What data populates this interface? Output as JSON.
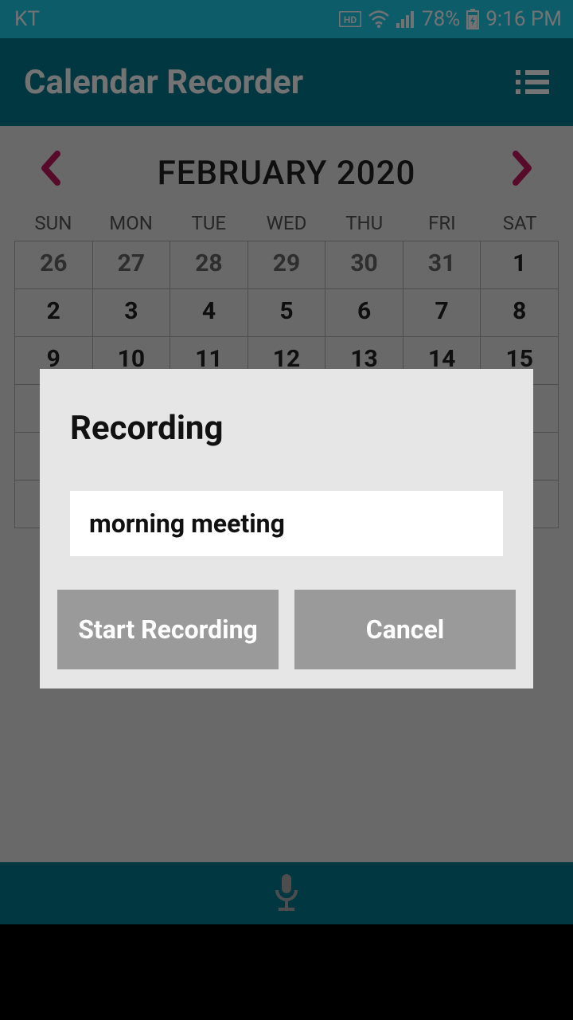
{
  "status": {
    "carrier": "KT",
    "battery": "78%",
    "time": "9:16 PM",
    "hd": "HD"
  },
  "appbar": {
    "title": "Calendar Recorder"
  },
  "calendar": {
    "month_label": "FEBRUARY 2020",
    "dow": [
      "SUN",
      "MON",
      "TUE",
      "WED",
      "THU",
      "FRI",
      "SAT"
    ],
    "rows": [
      [
        {
          "d": "26",
          "other": true
        },
        {
          "d": "27",
          "other": true
        },
        {
          "d": "28",
          "other": true
        },
        {
          "d": "29",
          "other": true
        },
        {
          "d": "30",
          "other": true
        },
        {
          "d": "31",
          "other": true
        },
        {
          "d": "1"
        }
      ],
      [
        {
          "d": "2"
        },
        {
          "d": "3"
        },
        {
          "d": "4"
        },
        {
          "d": "5"
        },
        {
          "d": "6"
        },
        {
          "d": "7"
        },
        {
          "d": "8"
        }
      ],
      [
        {
          "d": "9"
        },
        {
          "d": "10"
        },
        {
          "d": "11"
        },
        {
          "d": "12"
        },
        {
          "d": "13"
        },
        {
          "d": "14"
        },
        {
          "d": "15"
        }
      ],
      [
        {
          "d": ""
        },
        {
          "d": ""
        },
        {
          "d": ""
        },
        {
          "d": ""
        },
        {
          "d": ""
        },
        {
          "d": ""
        },
        {
          "d": ""
        }
      ],
      [
        {
          "d": ""
        },
        {
          "d": ""
        },
        {
          "d": ""
        },
        {
          "d": ""
        },
        {
          "d": ""
        },
        {
          "d": ""
        },
        {
          "d": ""
        }
      ],
      [
        {
          "d": ""
        },
        {
          "d": ""
        },
        {
          "d": ""
        },
        {
          "d": ""
        },
        {
          "d": ""
        },
        {
          "d": ""
        },
        {
          "d": ""
        }
      ]
    ]
  },
  "dialog": {
    "title": "Recording",
    "input_value": "morning meeting",
    "start_label": "Start Recording",
    "cancel_label": "Cancel"
  }
}
